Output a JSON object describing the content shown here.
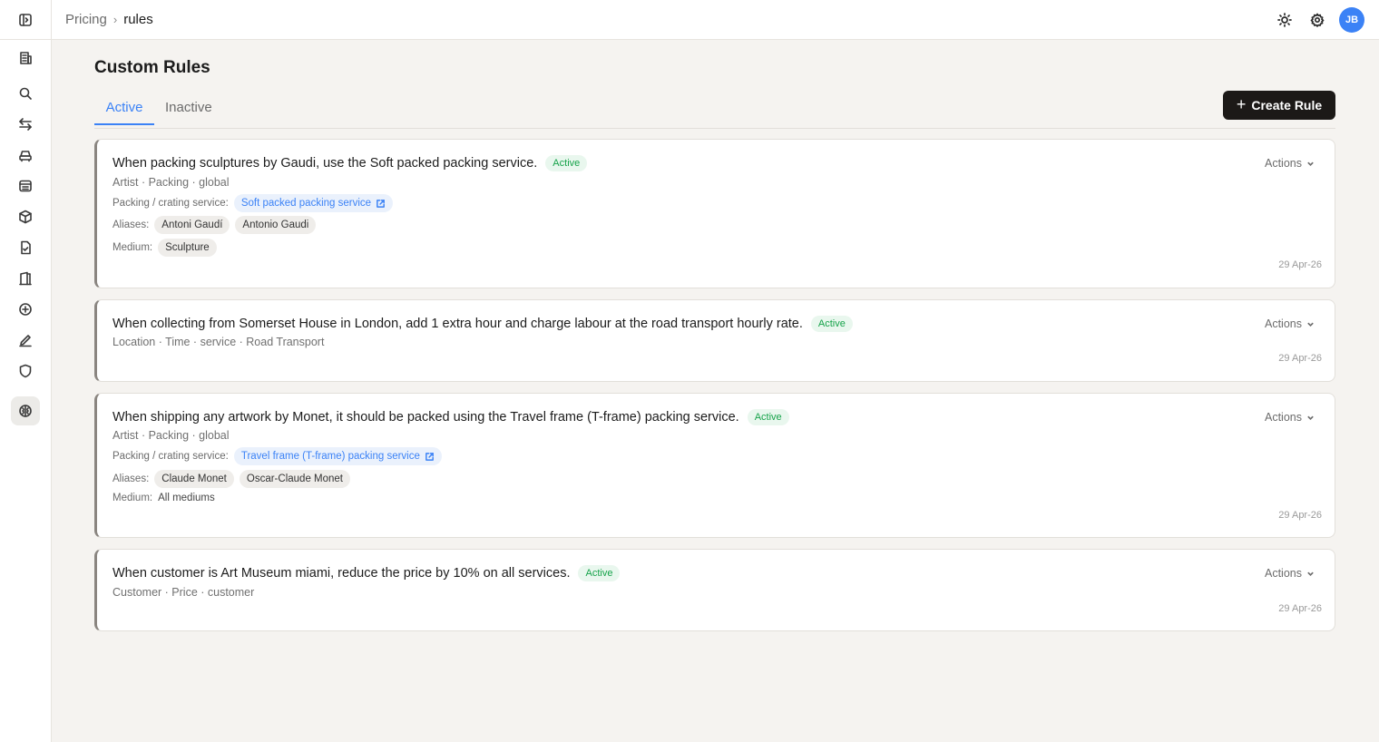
{
  "breadcrumb": {
    "parent": "Pricing",
    "current": "rules"
  },
  "user": {
    "initials": "JB",
    "avatar_color": "#3b82f6"
  },
  "page": {
    "title": "Custom Rules"
  },
  "tabs": [
    {
      "label": "Active"
    },
    {
      "label": "Inactive"
    }
  ],
  "create_button": {
    "label": "Create Rule"
  },
  "actions_label": "Actions",
  "rules": [
    {
      "title": "When packing sculptures by Gaudi, use the Soft packed packing service.",
      "status": "Active",
      "meta": "Artist · Packing · global",
      "service_label": "Packing / crating service:",
      "service": "Soft packed packing service",
      "aliases_label": "Aliases:",
      "aliases": [
        "Antoni Gaudí",
        "Antonio Gaudi"
      ],
      "medium_label": "Medium:",
      "medium": "Sculpture",
      "date": "29 Apr-26"
    },
    {
      "title": "When collecting from Somerset House in London, add 1 extra hour and charge labour at the road transport hourly rate.",
      "status": "Active",
      "meta": "Location · Time · service · Road Transport",
      "date": "29 Apr-26"
    },
    {
      "title": "When shipping any artwork by Monet, it should be packed using the Travel frame (T-frame) packing service.",
      "status": "Active",
      "meta": "Artist · Packing · global",
      "service_label": "Packing / crating service:",
      "service": "Travel frame (T-frame) packing service",
      "aliases_label": "Aliases:",
      "aliases": [
        "Claude Monet",
        "Oscar-Claude Monet"
      ],
      "medium_label": "Medium:",
      "medium": "All mediums",
      "date": "29 Apr-26"
    },
    {
      "title": "When customer is Art Museum miami, reduce the price by 10% on all services.",
      "status": "Active",
      "meta": "Customer · Price · customer",
      "date": "29 Apr-26"
    }
  ],
  "colors": {
    "accent": "#3b82f6",
    "status_active": "#16a34a",
    "primary_button": "#1c1917"
  }
}
